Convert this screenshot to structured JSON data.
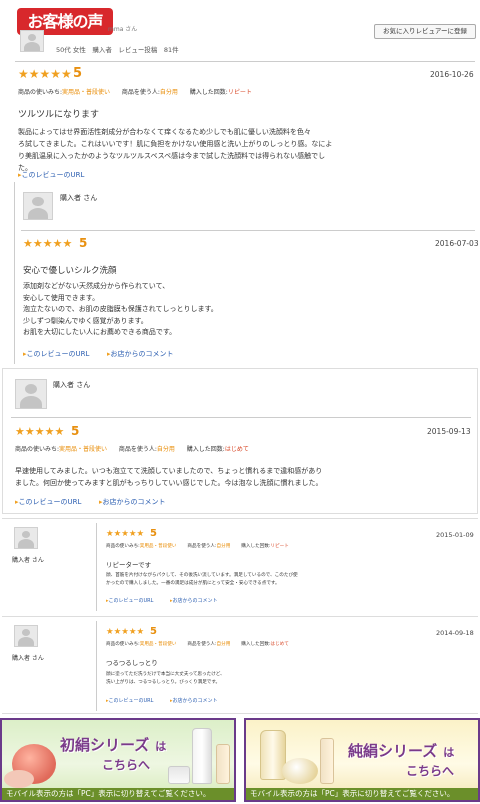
{
  "header": {
    "logo_text": "お客様の声",
    "reviewer_name_suffix": "mma さん",
    "reviewer_profile": "50代 女性　購入者　レビュー投稿　81件",
    "favorite_button": "お気に入りレビュアーに登録"
  },
  "reviews": [
    {
      "stars": "★★★★★",
      "score": "5",
      "date": "2016-10-26",
      "meta_label_use": "商品の使いみち:",
      "meta_use": "実用品・普段使い",
      "meta_label_who": "商品を使う人:",
      "meta_who": "自分用",
      "meta_label_freq": "購入した回数:",
      "meta_freq": "リピート",
      "title": "ツルツルになります",
      "body": [
        "製品によってはせ界面活性剤成分が合わなくて痒くなるため少しでも肌に優しい洗顔料を色々",
        "ろ試してきました。これはいいです！肌に負担をかけない使用感と洗い上がりのしっとり感。なによ",
        "り美肌温泉に入ったかのようなツルツルスベスベ感は今まで試した洗顔料では得られない感触でし",
        "た。"
      ],
      "link_url": "このレビューのURL"
    },
    {
      "reviewer": "購入者 さん",
      "stars": "★★★★★",
      "score": "5",
      "date": "2016-07-03",
      "title": "安心で優しいシルク洗顔",
      "body": [
        "添加剤などがない天然成分から作られていて、",
        "安心して使用できます。",
        "泡立たないので、お肌の皮脂膜も保護されてしっとりします。",
        "少しずつ馴染んでゆく感覚があります。",
        "お肌を大切にしたい人にお薦めできる商品です。"
      ],
      "link_url": "このレビューのURL",
      "link_comment": "お店からのコメント"
    },
    {
      "reviewer": "購入者 さん",
      "stars": "★★★★★",
      "score": "5",
      "date": "2015-09-13",
      "meta_label_use": "商品の使いみち:",
      "meta_use": "実用品・普段使い",
      "meta_label_who": "商品を使う人:",
      "meta_who": "自分用",
      "meta_label_freq": "購入した回数:",
      "meta_freq": "はじめて",
      "body": [
        "早速使用してみました。いつも泡立てて洗顔していましたので、ちょっと慣れるまで違和感があり",
        "ました。何回か使ってみますと肌がもっちりしていい感じでした。今は泡なし洗顔に慣れました。"
      ],
      "link_url": "このレビューのURL",
      "link_comment": "お店からのコメント"
    },
    {
      "reviewer": "購入者 さん",
      "stars": "★★★★★",
      "score": "5",
      "date": "2015-01-09",
      "meta_label_use": "商品の使いみち:",
      "meta_use": "実用品・普段使い",
      "meta_label_who": "商品を使う人:",
      "meta_who": "自分用",
      "meta_label_freq": "購入した回数:",
      "meta_freq": "リピート",
      "title": "リピーターです",
      "body": [
        "顔、首筋を片付けながらパクして、その後洗い流しています。満足しているので、このたび使",
        "かったので購入しました。一番の満足は成分が肌にとって安全・安心できる点です。"
      ],
      "link_url": "このレビューのURL",
      "link_comment": "お店からのコメント"
    },
    {
      "reviewer": "購入者 さん",
      "stars": "★★★★★",
      "score": "5",
      "date": "2014-09-18",
      "meta_label_use": "商品の使いみち:",
      "meta_use": "実用品・普段使い",
      "meta_label_who": "商品を使う人:",
      "meta_who": "自分用",
      "meta_label_freq": "購入した回数:",
      "meta_freq": "はじめて",
      "title": "つるつるしっとり",
      "body": [
        "顔に塗ってただ洗うだけで本当に大丈夫って思ったけど、",
        "洗い上がりは、つるつるしっとり。びっくり満足です。"
      ],
      "link_url": "このレビューのURL",
      "link_comment": "お店からのコメント"
    }
  ],
  "banners": [
    {
      "title1": "初絹シリーズ",
      "title1b": "は",
      "title2": "こちらへ",
      "footer": "モバイル表示の方は「PC」表示に切り替えてご覧ください。"
    },
    {
      "title1": "純絹シリーズ",
      "title1b": "は",
      "title2": "こちらへ",
      "footer": "モバイル表示の方は「PC」表示に切り替えてご覧ください。"
    }
  ]
}
